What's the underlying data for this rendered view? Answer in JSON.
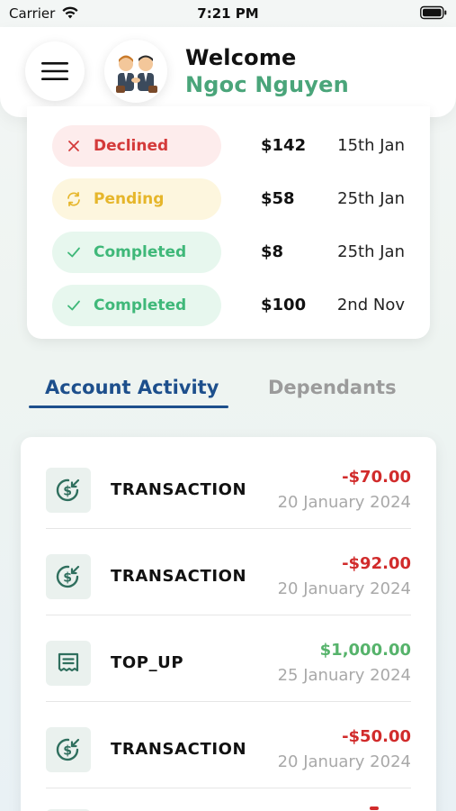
{
  "status_bar": {
    "carrier": "Carrier",
    "time": "7:21 PM"
  },
  "header": {
    "welcome": "Welcome",
    "user_name": "Ngoc Nguyen",
    "menu_icon": "hamburger-icon",
    "avatar": "two-businessmen-avatar"
  },
  "status_list": [
    {
      "status": "Declined",
      "amount": "$142",
      "date": "15th Jan",
      "icon": "close-icon"
    },
    {
      "status": "Pending",
      "amount": "$58",
      "date": "25th Jan",
      "icon": "refresh-icon"
    },
    {
      "status": "Completed",
      "amount": "$8",
      "date": "25th Jan",
      "icon": "check-icon"
    },
    {
      "status": "Completed",
      "amount": "$100",
      "date": "2nd Nov",
      "icon": "check-icon"
    }
  ],
  "tabs": [
    {
      "label": "Account Activity",
      "active": true
    },
    {
      "label": "Dependants",
      "active": false
    }
  ],
  "activity": [
    {
      "type": "TRANSACTION",
      "amount": "-$70.00",
      "date": "20 January 2024",
      "icon": "dollar-incoming-icon",
      "kind": "debit"
    },
    {
      "type": "TRANSACTION",
      "amount": "-$92.00",
      "date": "20 January 2024",
      "icon": "dollar-incoming-icon",
      "kind": "debit"
    },
    {
      "type": "TOP_UP",
      "amount": "$1,000.00",
      "date": "25 January 2024",
      "icon": "receipt-icon",
      "kind": "credit"
    },
    {
      "type": "TRANSACTION",
      "amount": "-$50.00",
      "date": "20 January 2024",
      "icon": "dollar-incoming-icon",
      "kind": "debit"
    }
  ],
  "colors": {
    "accent_blue": "#1d4f8c",
    "name_green": "#4aa57a",
    "debit_red": "#d12b2b",
    "credit_green": "#56b36b",
    "declined": "#d43a3a",
    "pending": "#e6b62b",
    "completed": "#3fb879"
  }
}
